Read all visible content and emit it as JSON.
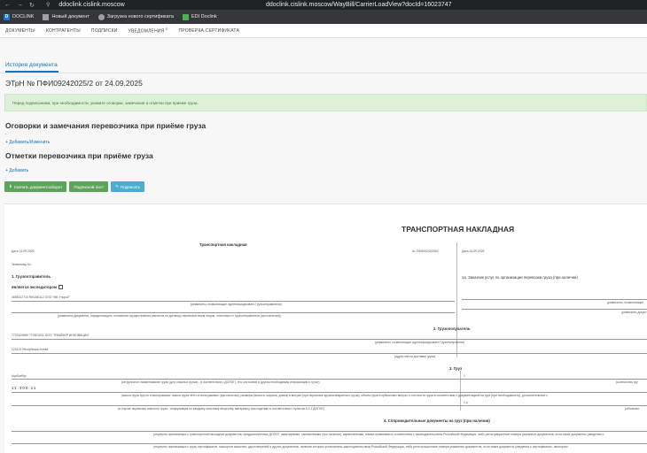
{
  "browser": {
    "host": "ddoclink.cislink.moscow",
    "url": "ddoclink.cislink.moscow/WayBill/CarrierLoadView?docId=16023747",
    "bookmarks": [
      "DOCLINK",
      "Новый документ",
      "Загрузка нового сертификата",
      "EDI Doclink"
    ]
  },
  "nav": {
    "items": [
      "ДОКУМЕНТЫ",
      "КОНТРАГЕНТЫ",
      "ПОДПИСКИ",
      "УВЕДОМЛЕНИЯ",
      "ПРОВЕРКА СЕРТИФИКАТА"
    ],
    "notifications_count": "0"
  },
  "page": {
    "history_tab": "История документа",
    "doc_title": "ЭТрН №   ПФИ09242025/2  от   24.09.2025",
    "alert": "Перед подписанием, при необходимости, укажите оговорки, замечания и отметки при приеме груза.",
    "section1_title": "Оговорки и замечания перевозчика при приёме груза",
    "section1_dash": "-",
    "section1_link": "Добавить/Изменить",
    "section2_title": "Отметки перевозчика при приёме груза",
    "section2_link": "Добавить",
    "buttons": {
      "download": "Скачать документооборот",
      "sign": "Подписной лист",
      "signing": "Подписать"
    }
  },
  "doc": {
    "main_title": "ТРАНСПОРТНАЯ НАКЛАДНАЯ",
    "sub_title": "Транспортная накладная",
    "date_left": "Дата  24.09.2025",
    "number": "№   ПФИ09242025/2",
    "date_right": "Дата 24.09.2025",
    "copy": "Экземпляр №:",
    "s1": "1. Грузоотправитель",
    "forwarder": "является экспедитором",
    "shipper_value": "4685312710 994156112 ООО \"МК Утаро2\"",
    "shipper_caption": "(реквизиты, позволяющие идентифицировать Грузоотправителя)",
    "shipper_doc_caption": "(реквизиты документа, определяющего основания осуществления расчетов по договору перевозки иным лицом, отличным от грузоотправителя (при наличии))",
    "s1a": "1а. Заказчик услуг по организации перевозки груза (при наличии)",
    "s1a_caption": "(реквизиты, позволяющие",
    "s1a_caption2": "(реквизиты докум",
    "s2": "2. Грузополучатель",
    "consignee_value": "7703109650 770301001 ООО \"ПФАЙЗЕР ИННОВАЦИИ\"",
    "consignee_caption": "(реквизиты, позволяющие идентифицировать Грузополучателя)",
    "address_value": "123123 Республика Алтай",
    "address_caption": "(адрес места доставки груза)",
    "s3": "3. Груз",
    "cargo_name": "Ацебсебус",
    "cargo_name_caption": "(отгрузочное наименование груза (для опасных грузов - в соответствии с ДОПОГ), его состояние и другая необходимая информация о грузе)",
    "cargo_places": "1",
    "cargo_places_caption": "(количество гру",
    "cargo_dims": "11.300.11",
    "cargo_dims_caption": "(масса груза брутто в килограммах, масса груза нетто в килограммах (при наличии), размеры (высота, ширина, длина) в метрах (при перевозке крупногабаритного груза), объем груза в кубических метрах и плотность груза в соответствии с документацией на груз (при необходимости), дополнительные с",
    "cargo_danger_caption": "(в случае перевозки опасного груза - информация по каждому опасному веществу, материалу или изделию в соответствии с пунктом 5.4.1 ДОПОГ)",
    "cargo_unit": "1 р",
    "cargo_unit_caption": "(объявлен",
    "s4": "4. Сопроводительные документы на груз (при наличии)",
    "s4_caption1": "(перечень прилагаемых к транспортной накладной документов, предусмотренных ДОПОГ, санитарными, таможенными (при наличии), карантинными, иными правилами в соответствии с законодательством Российской Федерации, либо регистрационные номера указанных документов, если такие документы (сведения о",
    "s4_caption2": "(перечень прилагаемых к грузу сертификатов, паспортов качества, удостоверений и других документов, наличие которых установлено законодательством Российской Федерации, либо регистрационные номера указанных документов, если такие документы (сведения о сертификатах, паспортах"
  }
}
